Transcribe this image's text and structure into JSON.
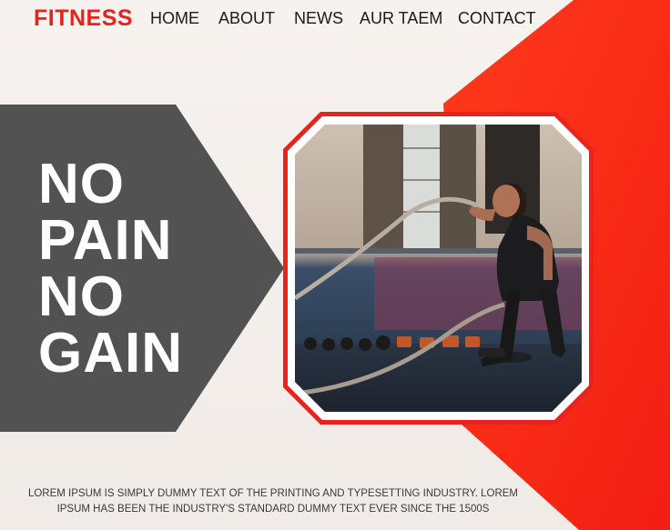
{
  "nav": {
    "brand": "FITNESS",
    "items": [
      {
        "label": "HOME"
      },
      {
        "label": "ABOUT"
      },
      {
        "label": "NEWS"
      },
      {
        "label": "AUR TAEM"
      },
      {
        "label": "CONTACT"
      }
    ]
  },
  "hero": {
    "slogan": [
      "NO",
      "PAIN",
      "NO",
      "GAIN"
    ],
    "caption_line1": "LOREM IPSUM IS SIMPLY DUMMY TEXT OF THE PRINTING AND TYPESETTING INDUSTRY. LOREM",
    "caption_line2": "IPSUM HAS BEEN THE INDUSTRY'S STANDARD DUMMY TEXT EVER SINCE THE 1500S"
  },
  "colors": {
    "accent": "#e8231d",
    "dark_panel": "#525252",
    "background": "#f3efec"
  }
}
